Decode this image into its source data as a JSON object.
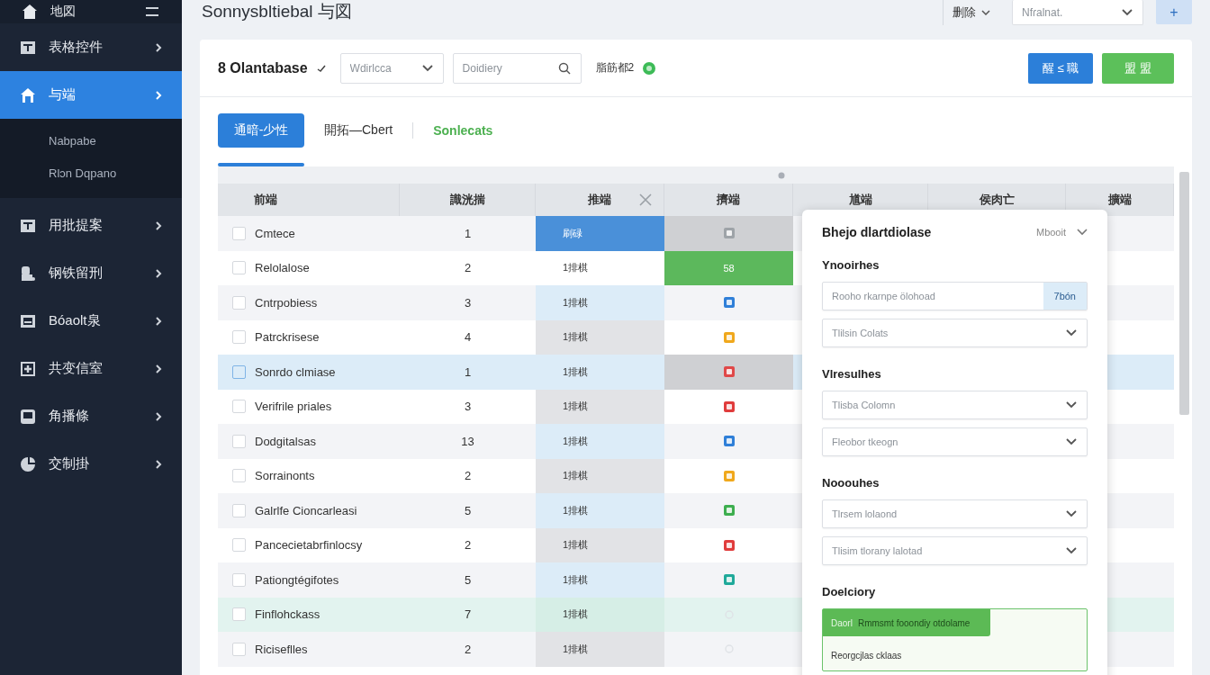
{
  "sidebar": {
    "header": {
      "label": "地図"
    },
    "items": [
      {
        "label": "表格控件",
        "selected": false
      },
      {
        "label": "与端",
        "selected": true,
        "children": [
          {
            "label": "Nabpabe"
          },
          {
            "label": "Rlɔn Dqpano"
          }
        ]
      },
      {
        "label": "用批提案",
        "selected": false
      },
      {
        "label": "钢铁留刑",
        "selected": false
      },
      {
        "label": "Bóaolt泉",
        "selected": false
      },
      {
        "label": "共变信室",
        "selected": false
      },
      {
        "label": "角播條",
        "selected": false
      },
      {
        "label": "交制掛",
        "selected": false
      }
    ]
  },
  "header": {
    "title": "Sonnysbltiebal 与図",
    "filter": "删除",
    "select": {
      "placeholder": "Nfɾalnat."
    },
    "add_button": "+"
  },
  "toolbar": {
    "database": "8 Olantabase",
    "select": {
      "placeholder": "Wdirlcca"
    },
    "search": {
      "placeholder": "Doidiery"
    },
    "status": "脂筋都2",
    "buttons": [
      {
        "label": "醒 ≤ 職",
        "kind": "primary"
      },
      {
        "label": "盟  盟",
        "kind": "success"
      }
    ]
  },
  "tabs": [
    {
      "label": "通暗-少性",
      "kind": "tab",
      "selected": true
    },
    {
      "label": "開拓—Cbert",
      "kind": "tab",
      "selected": false
    },
    {
      "label": "Sonlecats",
      "kind": "link",
      "selected": false
    }
  ],
  "table": {
    "columns": [
      {
        "label": "前端"
      },
      {
        "label": "識洸揣"
      },
      {
        "label": "推端",
        "closable": true
      },
      {
        "label": "擠端"
      },
      {
        "label": "馗端"
      },
      {
        "label": "侯肉亡"
      },
      {
        "label": "擴端"
      }
    ],
    "rows": [
      {
        "selected": false,
        "kind": "plain",
        "checked": false,
        "name": "Cmtece",
        "count": "1",
        "value": {
          "text": "刷碌",
          "kind": "accent"
        },
        "mark": {
          "kind": "icon",
          "color": "#9ea3a8",
          "highlighted": true
        }
      },
      {
        "selected": false,
        "kind": "plain",
        "checked": false,
        "name": "Relolalose",
        "count": "2",
        "value": {
          "text": "1排棋",
          "kind": "plain"
        },
        "mark": {
          "kind": "badge",
          "color": "#5cb85c",
          "text": "58"
        }
      },
      {
        "selected": false,
        "kind": "plain",
        "checked": false,
        "name": "Cntrpobiess",
        "count": "3",
        "value": {
          "text": "1排棋",
          "kind": "info"
        },
        "mark": {
          "kind": "icon",
          "color": "#2f7fd8",
          "highlighted": false
        }
      },
      {
        "selected": false,
        "kind": "plain",
        "checked": false,
        "name": "Patrckrisese",
        "count": "4",
        "value": {
          "text": "1排棋",
          "kind": "muted"
        },
        "mark": {
          "kind": "icon",
          "color": "#f0a81c",
          "highlighted": false
        }
      },
      {
        "selected": true,
        "kind": "plain",
        "checked": false,
        "name": "Sonrdo clmiase",
        "count": "1",
        "value": {
          "text": "1排棋",
          "kind": "info"
        },
        "mark": {
          "kind": "icon",
          "color": "#e04848",
          "highlighted": true
        }
      },
      {
        "selected": false,
        "kind": "plain",
        "checked": false,
        "name": "Verifrile priales",
        "count": "3",
        "value": {
          "text": "1排棋",
          "kind": "muted"
        },
        "mark": {
          "kind": "icon",
          "color": "#e03c3c",
          "highlighted": false
        }
      },
      {
        "selected": false,
        "kind": "plain",
        "checked": false,
        "name": "Dodgitalsas",
        "count": "13",
        "value": {
          "text": "1排棋",
          "kind": "info"
        },
        "mark": {
          "kind": "icon",
          "color": "#2f7fd8",
          "highlighted": false
        }
      },
      {
        "selected": false,
        "kind": "plain",
        "checked": false,
        "name": "Sorrainonts",
        "count": "2",
        "value": {
          "text": "1排棋",
          "kind": "muted"
        },
        "mark": {
          "kind": "icon",
          "color": "#f0a81c",
          "highlighted": false
        }
      },
      {
        "selected": false,
        "kind": "plain",
        "checked": false,
        "name": "Galrlfe Cioncarleasi",
        "count": "5",
        "value": {
          "text": "1排棋",
          "kind": "info"
        },
        "mark": {
          "kind": "icon",
          "color": "#3dae4f",
          "highlighted": false
        }
      },
      {
        "selected": false,
        "kind": "plain",
        "checked": false,
        "name": "Pancecietabrfinlocsy",
        "count": "2",
        "value": {
          "text": "1排棋",
          "kind": "muted"
        },
        "mark": {
          "kind": "icon",
          "color": "#e03c3c",
          "highlighted": false
        }
      },
      {
        "selected": false,
        "kind": "plain",
        "checked": false,
        "name": "Pationgtégifotes",
        "count": "5",
        "value": {
          "text": "1排棋",
          "kind": "info"
        },
        "mark": {
          "kind": "icon",
          "color": "#1fa99a",
          "highlighted": false
        }
      },
      {
        "selected": false,
        "kind": "success",
        "checked": false,
        "name": "Finflohckass",
        "count": "7",
        "value": {
          "text": "1排棋",
          "kind": "success"
        },
        "mark": {
          "kind": "dot"
        }
      },
      {
        "selected": false,
        "kind": "plain",
        "checked": false,
        "name": "Riciseflles",
        "count": "2",
        "value": {
          "text": "1排棋",
          "kind": "muted"
        },
        "mark": {
          "kind": "dot"
        }
      }
    ]
  },
  "panel": {
    "title": "Bhejo dlaɾtdiolase",
    "mode": "Mbooit",
    "sections": [
      {
        "heading": "Ynooirhes",
        "fields": [
          {
            "kind": "input",
            "placeholder": "Rooho rkarnpe ölohoad",
            "suffix": "7bón"
          },
          {
            "kind": "select",
            "placeholder": "Tlilsin Colats"
          }
        ]
      },
      {
        "heading": "Vlresulhes",
        "fields": [
          {
            "kind": "select",
            "placeholder": "Tlisba Colomn"
          },
          {
            "kind": "select",
            "placeholder": "Fleobor tkeogn"
          }
        ]
      },
      {
        "heading": "Nooouhes",
        "fields": [
          {
            "kind": "select",
            "placeholder": "Tlrsem lolaond"
          },
          {
            "kind": "select",
            "placeholder": "Tlisim tlorany lalotad"
          }
        ]
      },
      {
        "heading": "Doelciory",
        "fields": [
          {
            "kind": "notice",
            "tag": "Daorl",
            "text": "Rmmsmt fooondiy otdolame",
            "note": "Reorgcjlas cklaas"
          }
        ]
      }
    ]
  }
}
